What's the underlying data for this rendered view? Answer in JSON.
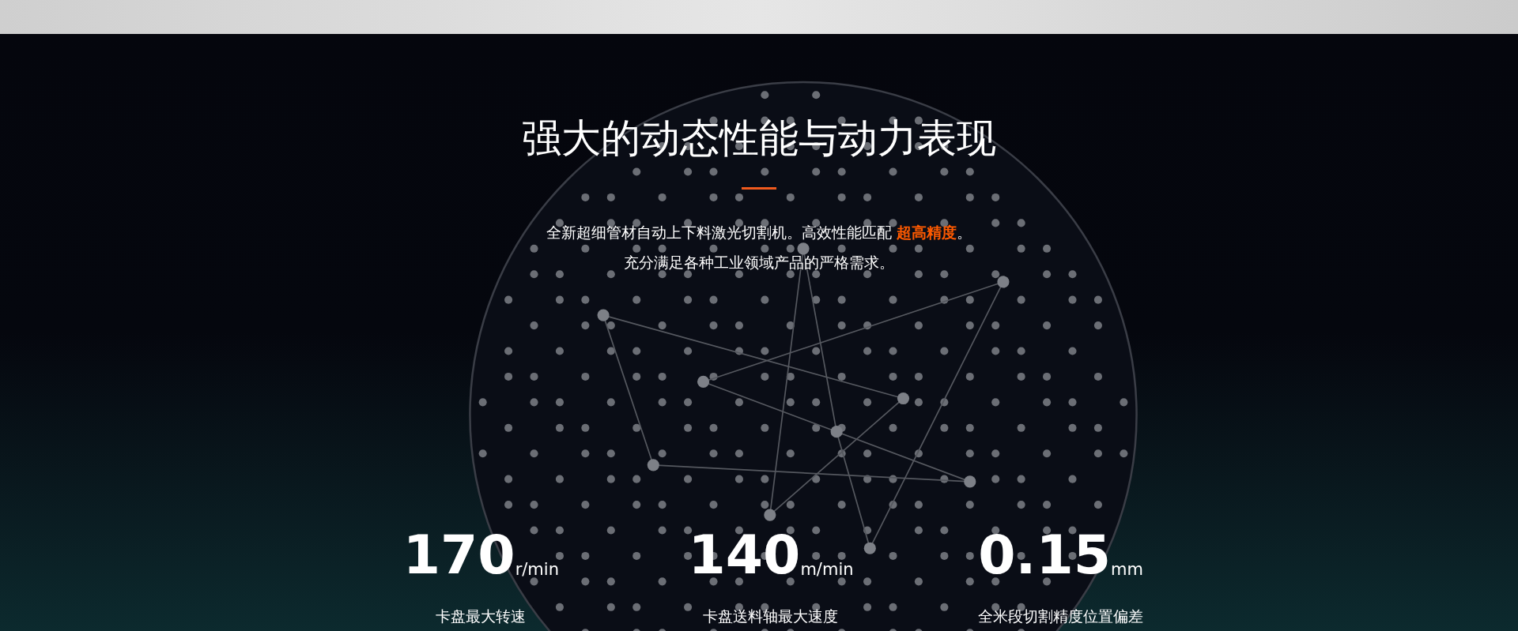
{
  "heading": "强大的动态性能与动力表现",
  "description": [
    "全新超细管材自动上下料激光切割机。高效性能匹配 **超高精度**。",
    "充分满足各种工业领域产品的严格需求。"
  ],
  "stats": [
    {
      "value": "170",
      "unit": "r/min",
      "label": "卡盘最大转速"
    },
    {
      "value": "140",
      "unit": "m/min",
      "label": "卡盘送料轴最大速度"
    },
    {
      "value": "0.15",
      "unit": "mm",
      "label": "全米段切割精度位置偏差"
    }
  ]
}
